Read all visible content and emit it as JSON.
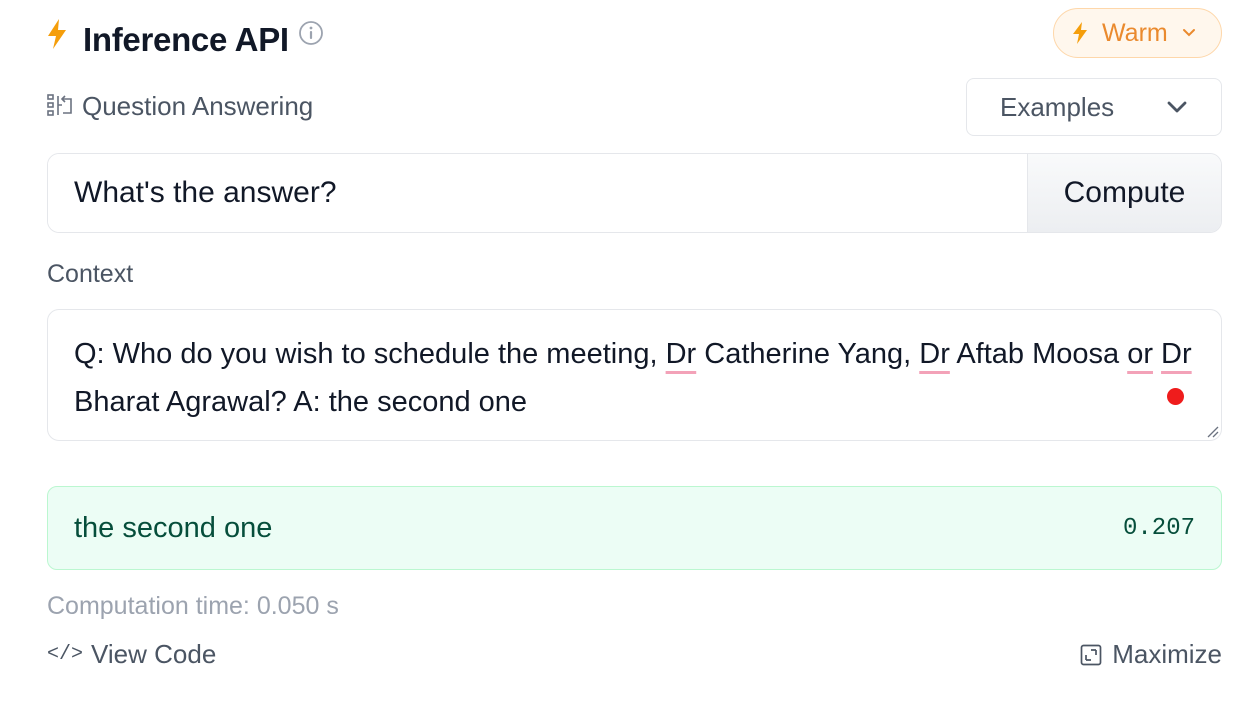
{
  "header": {
    "title": "Inference API",
    "status_button": "Warm",
    "accent_color": "#f59e0b"
  },
  "task": {
    "label": "Question Answering",
    "icon": "question-answering-icon"
  },
  "examples": {
    "label": "Examples"
  },
  "question": {
    "value": "What's the answer?",
    "compute_label": "Compute"
  },
  "context": {
    "label": "Context",
    "text_parts": [
      "Q: Who do you wish to schedule the meeting, ",
      "Dr",
      " Catherine Yang, ",
      "Dr",
      " Aftab Moosa ",
      "or",
      " ",
      "Dr",
      " Bharat Agrawal? A: the second one"
    ]
  },
  "result": {
    "answer": "the second one",
    "score": "0.207",
    "computation_time": "Computation time: 0.050 s"
  },
  "footer": {
    "view_code": "View Code",
    "view_code_icon": "</>",
    "maximize": "Maximize"
  }
}
